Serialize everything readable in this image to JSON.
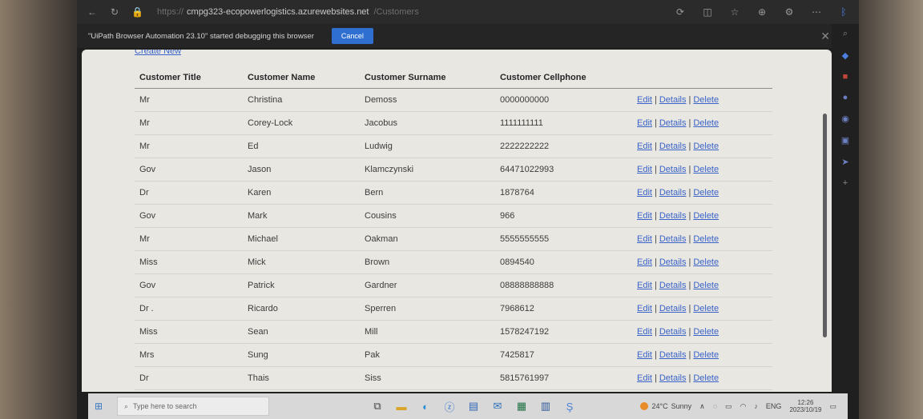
{
  "browser": {
    "address_prefix": "https://",
    "address": "cmpg323-ecopowerlogistics.azurewebsites.net",
    "address_suffix": "/Customers"
  },
  "banner": {
    "text": "\"UiPath Browser Automation 23.10\" started debugging this browser",
    "cancel_label": "Cancel"
  },
  "page": {
    "create_new_label": "Create New",
    "columns": [
      "Customer Title",
      "Customer Name",
      "Customer Surname",
      "Customer Cellphone"
    ],
    "rows": [
      [
        "Mr",
        "Christina",
        "Demoss",
        "0000000000"
      ],
      [
        "Mr",
        "Corey-Lock",
        "Jacobus",
        "1111111111"
      ],
      [
        "Mr",
        "Ed",
        "Ludwig",
        "2222222222"
      ],
      [
        "Gov",
        "Jason",
        "Klamczynski",
        "64471022993"
      ],
      [
        "Dr",
        "Karen",
        "Bern",
        "1878764"
      ],
      [
        "Gov",
        "Mark",
        "Cousins",
        "966"
      ],
      [
        "Mr",
        "Michael",
        "Oakman",
        "5555555555"
      ],
      [
        "Miss",
        "Mick",
        "Brown",
        "0894540"
      ],
      [
        "Gov",
        "Patrick",
        "Gardner",
        "08888888888"
      ],
      [
        "Dr .",
        "Ricardo",
        "Sperren",
        "7968612"
      ],
      [
        "Miss",
        "Sean",
        "Mill",
        "1578247192"
      ],
      [
        "Mrs",
        "Sung",
        "Pak",
        "7425817"
      ],
      [
        "Dr",
        "Thais",
        "Siss",
        "5815761997"
      ]
    ],
    "actions": [
      "Edit",
      "Details",
      "Delete"
    ]
  },
  "taskbar": {
    "search_placeholder": "Type here to search",
    "temperature": "24°C",
    "condition": "Sunny",
    "language": "ENG",
    "time": "12:26",
    "date": "2023/10/19"
  }
}
